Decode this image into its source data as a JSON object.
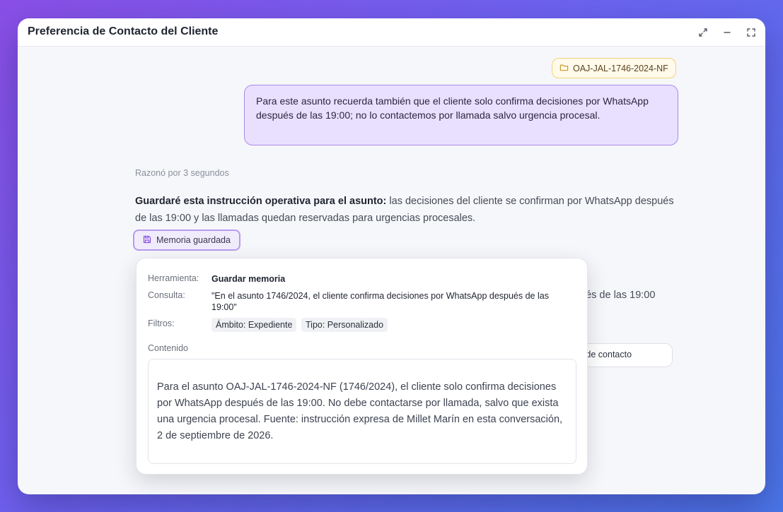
{
  "window": {
    "title": "Preferencia de Contacto del Cliente",
    "controls": [
      "collapse-arrows-icon",
      "minimize-icon",
      "fullscreen-icon"
    ]
  },
  "matter_chip": {
    "icon": "folder-icon",
    "label": "OAJ-JAL-1746-2024-NF"
  },
  "user_message": "Para este asunto recuerda también que el cliente solo confirma decisiones por WhatsApp después de las 19:00; no lo contactemos por llamada salvo urgencia procesal.",
  "reasoning": "Razonó por 3 segundos",
  "assistant": {
    "bold": "Guardaré esta instrucción operativa para el asunto:",
    "text": " las decisiones del cliente se confirman por WhatsApp después de las 19:00 y las llamadas quedan reservadas para urgencias procesales."
  },
  "memory_button": {
    "icon": "save-icon",
    "label": "Memoria guardada"
  },
  "background": {
    "partial_text": "ués de las 19:00",
    "partial_pill": "o de contacto"
  },
  "popover": {
    "tool_label": "Herramienta:",
    "tool_value": "Guardar memoria",
    "query_label": "Consulta:",
    "query_value": "\"En el asunto 1746/2024, el cliente confirma decisiones por WhatsApp después de las 19:00\"",
    "filters_label": "Filtros:",
    "filters": [
      "Ámbito: Expediente",
      "Tipo: Personalizado"
    ],
    "content_label": "Contenido",
    "content": "Para el asunto OAJ-JAL-1746-2024-NF (1746/2024), el cliente solo confirma decisiones por WhatsApp después de las 19:00. No debe contactarse por llamada, salvo que exista una urgencia procesal. Fuente: instrucción expresa de Millet Marín en esta conversación, 2 de septiembre de 2026."
  },
  "colors": {
    "accent_purple": "#a98be8",
    "user_bubble": "#e9e0ff",
    "chip_border": "#f3d27a"
  }
}
